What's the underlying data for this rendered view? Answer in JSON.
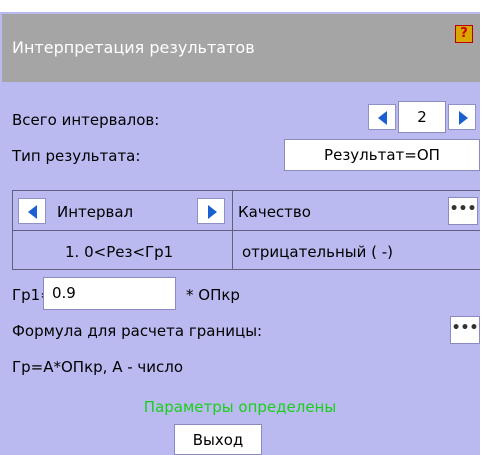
{
  "window": {
    "title": "Интерпретация результатов",
    "help_label": "?"
  },
  "intervals": {
    "label": "Всего интервалов:",
    "value": "2"
  },
  "result_type": {
    "label": "Тип результата:",
    "button_label": "Результат=ОП"
  },
  "table": {
    "col1_header": "Интервал",
    "col2_header": "Качество",
    "dots_label": "•••",
    "rows": [
      {
        "interval": "1. 0<Рез<Гр1",
        "quality": "отрицательный ( -)"
      }
    ]
  },
  "gr1": {
    "label": "Гр1=",
    "value": "0.9",
    "suffix": "* ОПкр"
  },
  "formula": {
    "label": "Формула для расчета границы:",
    "dots_label": "•••",
    "text": "Гр=А*ОПкр, А - число"
  },
  "status": {
    "text": "Параметры определены",
    "color": "#18d018"
  },
  "exit_button": {
    "label": "Выход"
  }
}
